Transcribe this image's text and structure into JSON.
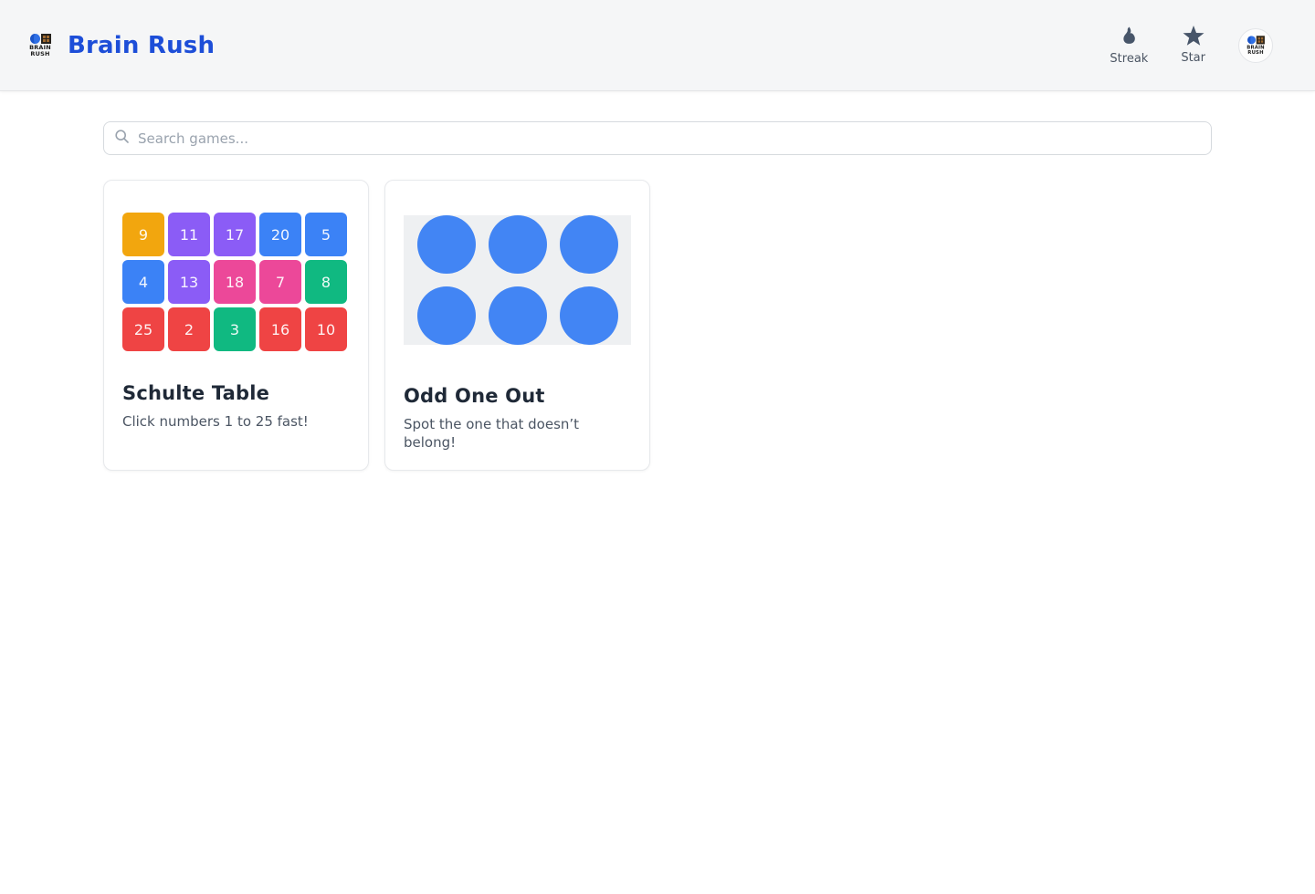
{
  "header": {
    "app_title": "Brain Rush",
    "logo": {
      "line1": "BRAIN",
      "line2": "RUSH"
    },
    "stats": [
      {
        "id": "streak",
        "icon": "flame-icon",
        "label": "Streak"
      },
      {
        "id": "star",
        "icon": "star-icon",
        "label": "Star"
      }
    ]
  },
  "search": {
    "placeholder": "Search games..."
  },
  "games": [
    {
      "id": "schulte-table",
      "title": "Schulte Table",
      "description": "Click numbers 1 to 25 fast!",
      "preview": {
        "type": "number-grid",
        "columns": 5,
        "tiles": [
          {
            "value": "9",
            "color": "orange"
          },
          {
            "value": "11",
            "color": "purple"
          },
          {
            "value": "17",
            "color": "purple"
          },
          {
            "value": "20",
            "color": "blue"
          },
          {
            "value": "5",
            "color": "blue"
          },
          {
            "value": "4",
            "color": "blue"
          },
          {
            "value": "13",
            "color": "purple"
          },
          {
            "value": "18",
            "color": "pink"
          },
          {
            "value": "7",
            "color": "pink"
          },
          {
            "value": "8",
            "color": "green"
          },
          {
            "value": "25",
            "color": "red"
          },
          {
            "value": "2",
            "color": "red"
          },
          {
            "value": "3",
            "color": "green"
          },
          {
            "value": "16",
            "color": "red"
          },
          {
            "value": "10",
            "color": "red"
          }
        ]
      }
    },
    {
      "id": "odd-one-out",
      "title": "Odd One Out",
      "description": "Spot the one that doesn’t belong!",
      "preview": {
        "type": "circles",
        "count": 6,
        "circle_color": "#4285f4",
        "clipped_arc_centers": [
          66,
          144,
          222
        ]
      }
    }
  ],
  "colors": {
    "accent_blue": "#1d4ed8",
    "icon_slate": "#475569",
    "tile_orange": "#f2a60e",
    "tile_purple": "#8b5cf6",
    "tile_blue": "#3b82f6",
    "tile_pink": "#ec4899",
    "tile_green": "#10b981",
    "tile_red": "#ef4444",
    "circle_blue": "#4285f4",
    "panel_gray": "#eef0f2",
    "arc_dark": "#232936"
  }
}
